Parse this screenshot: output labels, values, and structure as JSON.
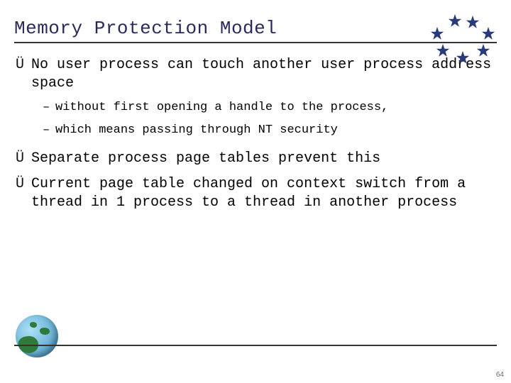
{
  "title": "Memory Protection Model",
  "bullets": {
    "b1": "No user process can touch another user process address space",
    "b1_sub1": "without first opening a handle to the process,",
    "b1_sub2": "which means passing through NT security",
    "b2": "Separate process page tables prevent this",
    "b3": "Current page table changed on context switch from a thread in 1 process to a thread in another process"
  },
  "glyphs": {
    "arrow": "Ü",
    "dash": "–"
  },
  "page_number": "64"
}
